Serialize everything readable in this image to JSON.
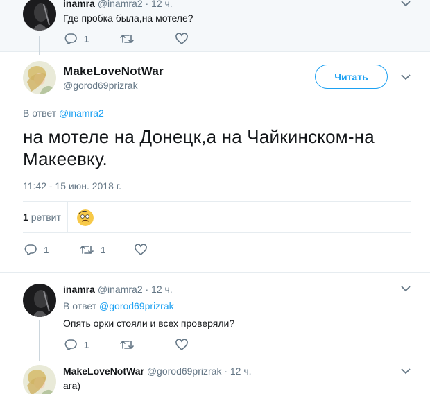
{
  "tweet1": {
    "name": "inamra",
    "handle": "@inamra2",
    "time": "· 12 ч.",
    "text": "Где пробка была,на мотеле?",
    "reply_count": "1"
  },
  "main": {
    "name": "MakeLoveNotWar",
    "handle": "@gorod69prizrak",
    "follow_label": "Читать",
    "reply_prefix": "В ответ",
    "reply_handle": "@inamra2",
    "text": "на мотеле на Донецк,а на Чайкинском-на Макеевку.",
    "timestamp": "11:42 - 15 июн. 2018 г.",
    "retweet_count": "1",
    "retweet_word": "ретвит",
    "reply_count": "1",
    "rt_count": "1"
  },
  "tweet3": {
    "name": "inamra",
    "handle": "@inamra2",
    "time": "· 12 ч.",
    "reply_prefix": "В ответ",
    "reply_handle": "@gorod69prizrak",
    "text": "Опять орки стояли и всех проверяли?",
    "reply_count": "1"
  },
  "tweet4": {
    "name": "MakeLoveNotWar",
    "handle": "@gorod69prizrak",
    "time": "· 12 ч.",
    "text": "ага)"
  },
  "colors": {
    "accent": "#1da1f2",
    "secondary_text": "#657786",
    "border": "#e6ecf0",
    "top_background": "#f5f8fa"
  },
  "icons": [
    "reply-icon",
    "retweet-icon",
    "like-icon",
    "chevron-down-icon"
  ]
}
